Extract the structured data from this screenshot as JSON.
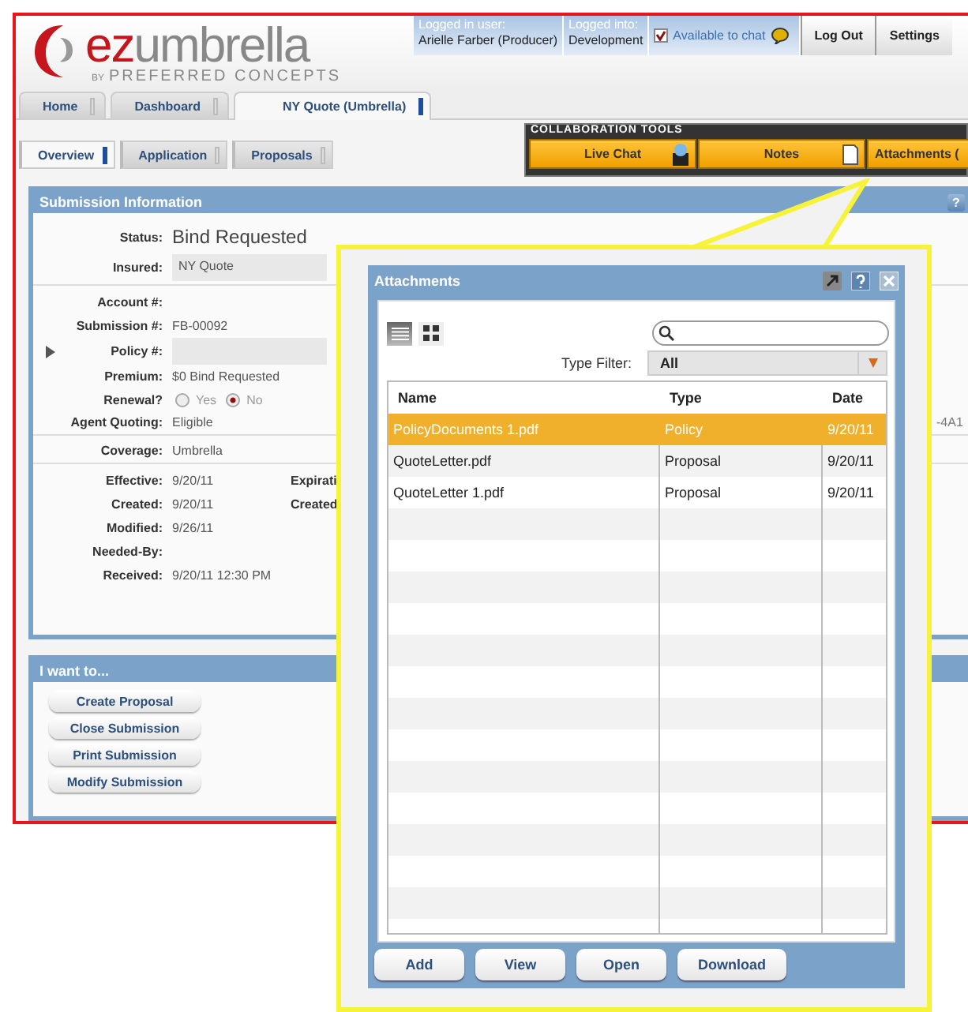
{
  "brand": {
    "lead": "ez",
    "tail": "umbrella",
    "by": "BY",
    "company": "PREFERRED CONCEPTS"
  },
  "session": {
    "user_label": "Logged in user:",
    "user": "Arielle Farber (Producer)",
    "env_label": "Logged into:",
    "env": "Development",
    "chat_available": true,
    "chat_label": "Available to chat"
  },
  "top_buttons": [
    "Log Out",
    "Settings"
  ],
  "tabs": [
    {
      "label": "Home",
      "selected": false
    },
    {
      "label": "Dashboard",
      "selected": false
    },
    {
      "label": "NY Quote (Umbrella)",
      "selected": true
    }
  ],
  "subtabs": [
    {
      "label": "Overview",
      "selected": true
    },
    {
      "label": "Application",
      "selected": false
    },
    {
      "label": "Proposals",
      "selected": false
    }
  ],
  "collaboration": {
    "title": "COLLABORATION TOOLS",
    "tools": [
      {
        "label": "Live Chat",
        "kind": "chat"
      },
      {
        "label": "Notes",
        "kind": "note"
      },
      {
        "label": "Attachments (",
        "kind": "plain"
      }
    ]
  },
  "submission": {
    "title": "Submission Information",
    "help": "?",
    "status_label": "Status:",
    "status": "Bind Requested",
    "fields": [
      {
        "kind": "boxed",
        "label": "Insured:",
        "value": "NY Quote",
        "divider": true
      },
      {
        "kind": "text",
        "label": "Account #:"
      },
      {
        "kind": "text",
        "label": "Submission #:",
        "value": "FB-00092"
      },
      {
        "kind": "expander",
        "label": "Policy #:"
      },
      {
        "kind": "text",
        "label": "Premium:",
        "value": "$0 Bind Requested"
      },
      {
        "kind": "radio",
        "label": "Renewal?",
        "options": [
          {
            "label": "Yes",
            "selected": false
          },
          {
            "label": "No",
            "selected": true
          }
        ]
      },
      {
        "kind": "text",
        "label": "Agent Quoting:",
        "value": "Eligible",
        "side_value": "-4A1",
        "divider": true
      },
      {
        "kind": "text",
        "label": "Coverage:",
        "value": "Umbrella",
        "divider": true
      },
      {
        "kind": "text",
        "label": "Effective:",
        "value": "9/20/11",
        "second_label": "Expirati"
      },
      {
        "kind": "text",
        "label": "Created:",
        "value": "9/20/11",
        "second_label": "Created"
      },
      {
        "kind": "text",
        "label": "Modified:",
        "value": "9/26/11"
      },
      {
        "kind": "text",
        "label": "Needed-By:"
      },
      {
        "kind": "text",
        "label": "Received:",
        "value": "9/20/11 12:30 PM"
      }
    ]
  },
  "actions": {
    "title": "I want to...",
    "buttons": [
      "Create Proposal",
      "Close Submission",
      "Print Submission",
      "Modify Submission"
    ]
  },
  "attachments": {
    "title": "Attachments",
    "view_modes": [
      {
        "kind": "list",
        "selected": true
      },
      {
        "kind": "grid",
        "selected": false
      }
    ],
    "filter_label": "Type Filter:",
    "filter_value": "All",
    "columns": [
      "Name",
      "Type",
      "Date"
    ],
    "rows": [
      {
        "cells": [
          "PolicyDocuments 1.pdf",
          "Policy",
          "9/20/11"
        ],
        "selected": true
      },
      {
        "cells": [
          "QuoteLetter.pdf",
          "Proposal",
          "9/20/11"
        ],
        "selected": false
      },
      {
        "cells": [
          "QuoteLetter 1.pdf",
          "Proposal",
          "9/20/11"
        ],
        "selected": false
      }
    ],
    "buttons": [
      "Add",
      "View",
      "Open",
      "Download"
    ]
  }
}
